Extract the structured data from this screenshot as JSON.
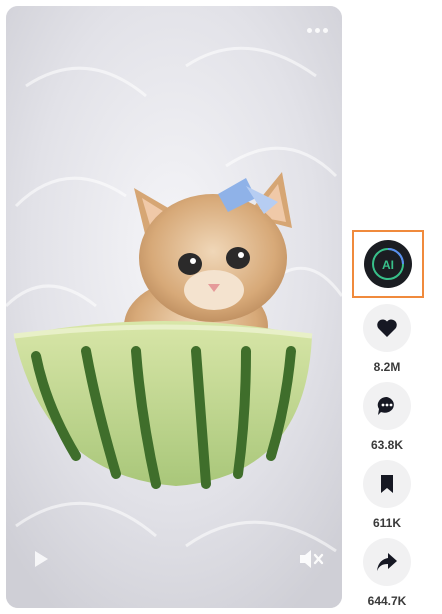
{
  "video": {
    "subject": "kitten-in-watermelon"
  },
  "creator": {
    "avatar_text": "AI",
    "accent": "#f08a3c"
  },
  "actions": {
    "like": {
      "count": "8.2M"
    },
    "comment": {
      "count": "63.8K"
    },
    "bookmark": {
      "count": "611K"
    },
    "share": {
      "count": "644.7K"
    }
  },
  "colors": {
    "icon": "#161823",
    "count_text": "#3a3a3a",
    "action_bg": "#f1f1f2"
  }
}
